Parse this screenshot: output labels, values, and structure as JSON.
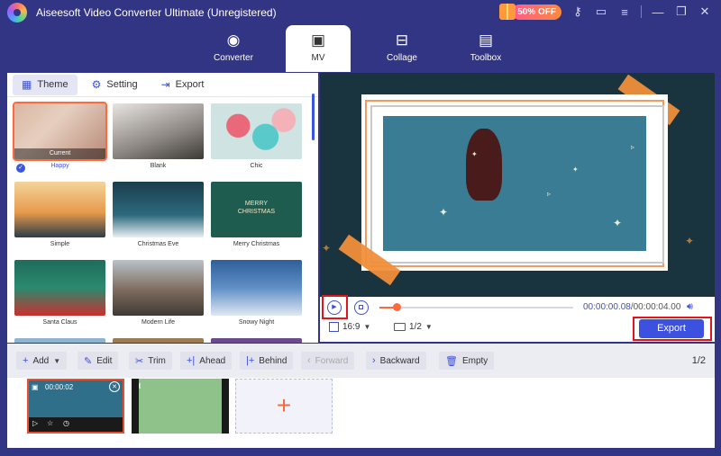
{
  "app": {
    "title": "Aiseesoft Video Converter Ultimate (Unregistered)",
    "promo": "50% OFF",
    "colors": {
      "accent": "#3d51e0",
      "window_bg": "#323584",
      "highlight": "#e1151b",
      "orange": "#ff6a3d"
    }
  },
  "nav": {
    "tabs": [
      {
        "label": "Converter",
        "icon": "converter-icon"
      },
      {
        "label": "MV",
        "icon": "mv-icon"
      },
      {
        "label": "Collage",
        "icon": "collage-icon"
      },
      {
        "label": "Toolbox",
        "icon": "toolbox-icon"
      }
    ],
    "active": "MV"
  },
  "left_panel": {
    "tabs": [
      {
        "label": "Theme",
        "icon": "theme-icon"
      },
      {
        "label": "Setting",
        "icon": "gear-icon"
      },
      {
        "label": "Export",
        "icon": "export-icon"
      }
    ],
    "active_tab": "Theme",
    "current_label": "Current",
    "themes": [
      {
        "name": "Happy",
        "selected": true
      },
      {
        "name": "Blank"
      },
      {
        "name": "Chic"
      },
      {
        "name": "Simple"
      },
      {
        "name": "Christmas Eve"
      },
      {
        "name": "Merry Christmas"
      },
      {
        "name": "Santa Claus"
      },
      {
        "name": "Modern Life"
      },
      {
        "name": "Snowy Night"
      }
    ]
  },
  "preview": {
    "time_current": "00:00:00.08",
    "time_total": "/00:00:04.00",
    "progress": 0.08,
    "aspect_ratio": "16:9",
    "page": "1/2",
    "export_label": "Export",
    "merry_text": "MERRY\nCHRISTMAS"
  },
  "toolbar": {
    "add": "Add",
    "edit": "Edit",
    "trim": "Trim",
    "ahead": "Ahead",
    "behind": "Behind",
    "forward": "Forward",
    "backward": "Backward",
    "empty": "Empty",
    "count_current": "1",
    "count_total": "2"
  },
  "timeline": {
    "clip1_time": "00:00:02",
    "add_symbol": "+"
  }
}
